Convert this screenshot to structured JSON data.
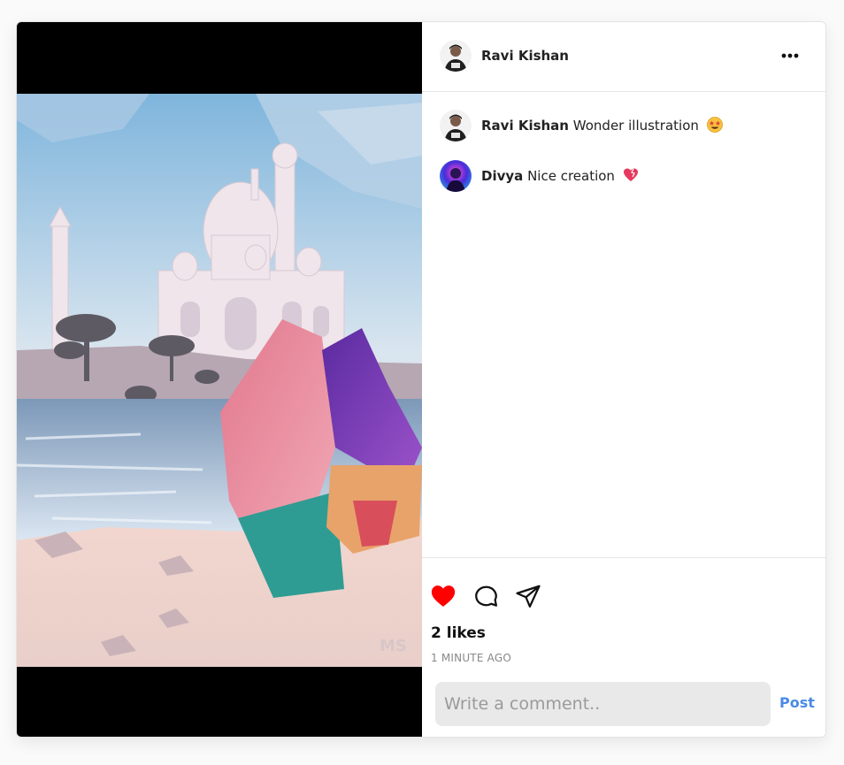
{
  "post": {
    "author": "Ravi Kishan",
    "image_alt": "Low-poly illustration of two women walking toward the Taj Mahal by the water",
    "image_watermark": "MS"
  },
  "comments": [
    {
      "user": "Ravi Kishan",
      "text": "Wonder illustration",
      "emoji": "star-struck-emoji"
    },
    {
      "user": "Divya",
      "text": "Nice creation",
      "emoji": "heart-emoji"
    }
  ],
  "actions": {
    "likes": "2 likes",
    "time": "1 MINUTE AGO",
    "liked": true,
    "like_color": "#ff0000"
  },
  "comment_box": {
    "placeholder": "Write a comment..",
    "post_label": "Post",
    "post_color": "#4a8ae8"
  }
}
